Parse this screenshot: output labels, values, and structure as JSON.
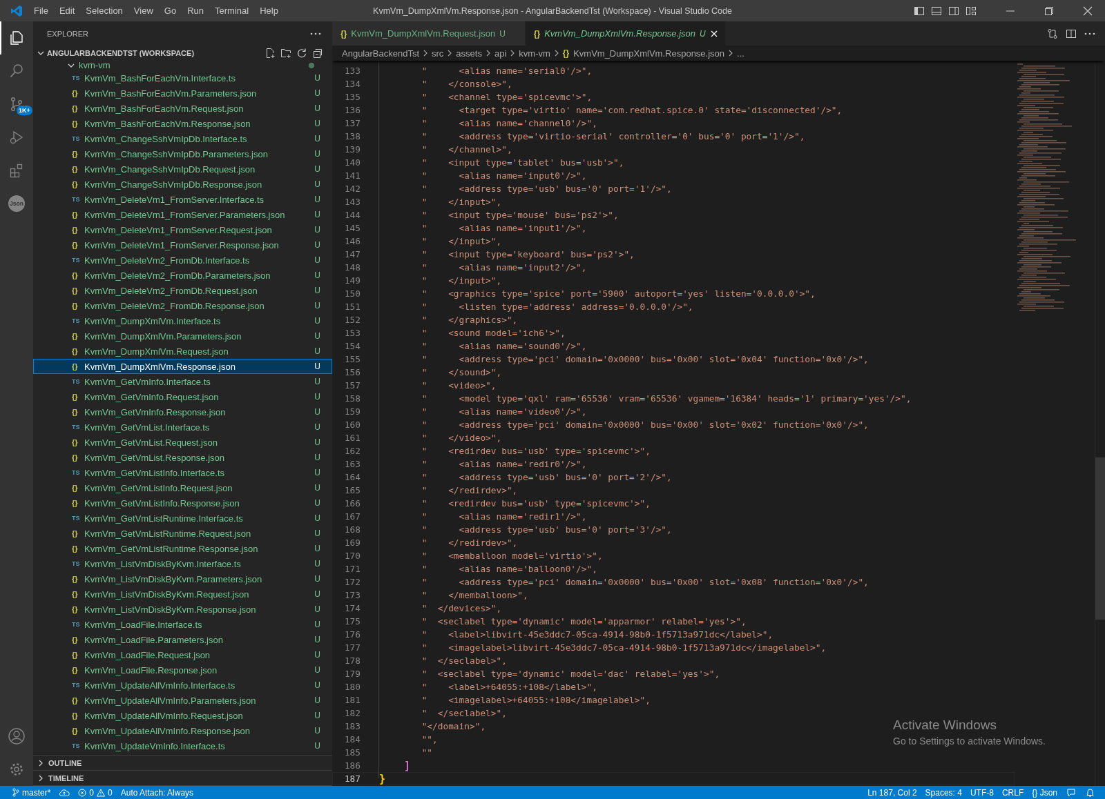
{
  "title_bar": {
    "menus": [
      "File",
      "Edit",
      "Selection",
      "View",
      "Go",
      "Run",
      "Terminal",
      "Help"
    ],
    "title": "KvmVm_DumpXmlVm.Response.json - AngularBackendTst (Workspace) - Visual Studio Code"
  },
  "activity_bar": {
    "source_control_badge": "1K+",
    "json_label": "Json"
  },
  "sidebar": {
    "title": "EXPLORER",
    "workspace": "ANGULARBACKENDTST (WORKSPACE)",
    "folder": {
      "name": "kvm-vm",
      "expanded": true,
      "modified": true
    },
    "files": [
      {
        "kind": "ts",
        "icon": "TS",
        "name": "KvmVm_BashForEachVm.Interface.ts",
        "badge": "U",
        "selected": false
      },
      {
        "kind": "json",
        "icon": "{}",
        "name": "KvmVm_BashForEachVm.Parameters.json",
        "badge": "U",
        "selected": false
      },
      {
        "kind": "json",
        "icon": "{}",
        "name": "KvmVm_BashForEachVm.Request.json",
        "badge": "U",
        "selected": false
      },
      {
        "kind": "json",
        "icon": "{}",
        "name": "KvmVm_BashForEachVm.Response.json",
        "badge": "U",
        "selected": false
      },
      {
        "kind": "ts",
        "icon": "TS",
        "name": "KvmVm_ChangeSshVmIpDb.Interface.ts",
        "badge": "U",
        "selected": false
      },
      {
        "kind": "json",
        "icon": "{}",
        "name": "KvmVm_ChangeSshVmIpDb.Parameters.json",
        "badge": "U",
        "selected": false
      },
      {
        "kind": "json",
        "icon": "{}",
        "name": "KvmVm_ChangeSshVmIpDb.Request.json",
        "badge": "U",
        "selected": false
      },
      {
        "kind": "json",
        "icon": "{}",
        "name": "KvmVm_ChangeSshVmIpDb.Response.json",
        "badge": "U",
        "selected": false
      },
      {
        "kind": "ts",
        "icon": "TS",
        "name": "KvmVm_DeleteVm1_FromServer.Interface.ts",
        "badge": "U",
        "selected": false
      },
      {
        "kind": "json",
        "icon": "{}",
        "name": "KvmVm_DeleteVm1_FromServer.Parameters.json",
        "badge": "U",
        "selected": false
      },
      {
        "kind": "json",
        "icon": "{}",
        "name": "KvmVm_DeleteVm1_FromServer.Request.json",
        "badge": "U",
        "selected": false
      },
      {
        "kind": "json",
        "icon": "{}",
        "name": "KvmVm_DeleteVm1_FromServer.Response.json",
        "badge": "U",
        "selected": false
      },
      {
        "kind": "ts",
        "icon": "TS",
        "name": "KvmVm_DeleteVm2_FromDb.Interface.ts",
        "badge": "U",
        "selected": false
      },
      {
        "kind": "json",
        "icon": "{}",
        "name": "KvmVm_DeleteVm2_FromDb.Parameters.json",
        "badge": "U",
        "selected": false
      },
      {
        "kind": "json",
        "icon": "{}",
        "name": "KvmVm_DeleteVm2_FromDb.Request.json",
        "badge": "U",
        "selected": false
      },
      {
        "kind": "json",
        "icon": "{}",
        "name": "KvmVm_DeleteVm2_FromDb.Response.json",
        "badge": "U",
        "selected": false
      },
      {
        "kind": "ts",
        "icon": "TS",
        "name": "KvmVm_DumpXmlVm.Interface.ts",
        "badge": "U",
        "selected": false
      },
      {
        "kind": "json",
        "icon": "{}",
        "name": "KvmVm_DumpXmlVm.Parameters.json",
        "badge": "U",
        "selected": false
      },
      {
        "kind": "json",
        "icon": "{}",
        "name": "KvmVm_DumpXmlVm.Request.json",
        "badge": "U",
        "selected": false
      },
      {
        "kind": "json",
        "icon": "{}",
        "name": "KvmVm_DumpXmlVm.Response.json",
        "badge": "U",
        "selected": true
      },
      {
        "kind": "ts",
        "icon": "TS",
        "name": "KvmVm_GetVmInfo.Interface.ts",
        "badge": "U",
        "selected": false
      },
      {
        "kind": "json",
        "icon": "{}",
        "name": "KvmVm_GetVmInfo.Request.json",
        "badge": "U",
        "selected": false
      },
      {
        "kind": "json",
        "icon": "{}",
        "name": "KvmVm_GetVmInfo.Response.json",
        "badge": "U",
        "selected": false
      },
      {
        "kind": "ts",
        "icon": "TS",
        "name": "KvmVm_GetVmList.Interface.ts",
        "badge": "U",
        "selected": false
      },
      {
        "kind": "json",
        "icon": "{}",
        "name": "KvmVm_GetVmList.Request.json",
        "badge": "U",
        "selected": false
      },
      {
        "kind": "json",
        "icon": "{}",
        "name": "KvmVm_GetVmList.Response.json",
        "badge": "U",
        "selected": false
      },
      {
        "kind": "ts",
        "icon": "TS",
        "name": "KvmVm_GetVmListInfo.Interface.ts",
        "badge": "U",
        "selected": false
      },
      {
        "kind": "json",
        "icon": "{}",
        "name": "KvmVm_GetVmListInfo.Request.json",
        "badge": "U",
        "selected": false
      },
      {
        "kind": "json",
        "icon": "{}",
        "name": "KvmVm_GetVmListInfo.Response.json",
        "badge": "U",
        "selected": false
      },
      {
        "kind": "ts",
        "icon": "TS",
        "name": "KvmVm_GetVmListRuntime.Interface.ts",
        "badge": "U",
        "selected": false
      },
      {
        "kind": "json",
        "icon": "{}",
        "name": "KvmVm_GetVmListRuntime.Request.json",
        "badge": "U",
        "selected": false
      },
      {
        "kind": "json",
        "icon": "{}",
        "name": "KvmVm_GetVmListRuntime.Response.json",
        "badge": "U",
        "selected": false
      },
      {
        "kind": "ts",
        "icon": "TS",
        "name": "KvmVm_ListVmDiskByKvm.Interface.ts",
        "badge": "U",
        "selected": false
      },
      {
        "kind": "json",
        "icon": "{}",
        "name": "KvmVm_ListVmDiskByKvm.Parameters.json",
        "badge": "U",
        "selected": false
      },
      {
        "kind": "json",
        "icon": "{}",
        "name": "KvmVm_ListVmDiskByKvm.Request.json",
        "badge": "U",
        "selected": false
      },
      {
        "kind": "json",
        "icon": "{}",
        "name": "KvmVm_ListVmDiskByKvm.Response.json",
        "badge": "U",
        "selected": false
      },
      {
        "kind": "ts",
        "icon": "TS",
        "name": "KvmVm_LoadFile.Interface.ts",
        "badge": "U",
        "selected": false
      },
      {
        "kind": "json",
        "icon": "{}",
        "name": "KvmVm_LoadFile.Parameters.json",
        "badge": "U",
        "selected": false
      },
      {
        "kind": "json",
        "icon": "{}",
        "name": "KvmVm_LoadFile.Request.json",
        "badge": "U",
        "selected": false
      },
      {
        "kind": "json",
        "icon": "{}",
        "name": "KvmVm_LoadFile.Response.json",
        "badge": "U",
        "selected": false
      },
      {
        "kind": "ts",
        "icon": "TS",
        "name": "KvmVm_UpdateAllVmInfo.Interface.ts",
        "badge": "U",
        "selected": false
      },
      {
        "kind": "json",
        "icon": "{}",
        "name": "KvmVm_UpdateAllVmInfo.Parameters.json",
        "badge": "U",
        "selected": false
      },
      {
        "kind": "json",
        "icon": "{}",
        "name": "KvmVm_UpdateAllVmInfo.Request.json",
        "badge": "U",
        "selected": false
      },
      {
        "kind": "json",
        "icon": "{}",
        "name": "KvmVm_UpdateAllVmInfo.Response.json",
        "badge": "U",
        "selected": false
      },
      {
        "kind": "ts",
        "icon": "TS",
        "name": "KvmVm_UpdateVmInfo.Interface.ts",
        "badge": "U",
        "selected": false
      }
    ],
    "sections": [
      {
        "label": "OUTLINE",
        "expanded": false
      },
      {
        "label": "TIMELINE",
        "expanded": false
      }
    ]
  },
  "tabs": [
    {
      "icon": "{}",
      "label": "KvmVm_DumpXmlVm.Request.json",
      "badge": "U",
      "selected": false,
      "preview": false
    },
    {
      "icon": "{}",
      "label": "KvmVm_DumpXmlVm.Response.json",
      "badge": "U",
      "selected": true,
      "preview": true
    }
  ],
  "breadcrumbs": [
    {
      "label": "AngularBackendTst"
    },
    {
      "label": "src"
    },
    {
      "label": "assets"
    },
    {
      "label": "api"
    },
    {
      "label": "kvm-vm"
    },
    {
      "label": "KvmVm_DumpXmlVm.Response.json",
      "icon": "{}"
    },
    {
      "label": "..."
    }
  ],
  "editor": {
    "lines": [
      {
        "number": "133",
        "kind": "string",
        "current": false,
        "text": "        \"      <alias name='serial0'/>\","
      },
      {
        "number": "134",
        "kind": "string",
        "current": false,
        "text": "        \"    </console>\","
      },
      {
        "number": "135",
        "kind": "string",
        "current": false,
        "text": "        \"    <channel type='spicevmc'>\","
      },
      {
        "number": "136",
        "kind": "string",
        "current": false,
        "text": "        \"      <target type='virtio' name='com.redhat.spice.0' state='disconnected'/>\","
      },
      {
        "number": "137",
        "kind": "string",
        "current": false,
        "text": "        \"      <alias name='channel0'/>\","
      },
      {
        "number": "138",
        "kind": "string",
        "current": false,
        "text": "        \"      <address type='virtio-serial' controller='0' bus='0' port='1'/>\","
      },
      {
        "number": "139",
        "kind": "string",
        "current": false,
        "text": "        \"    </channel>\","
      },
      {
        "number": "140",
        "kind": "string",
        "current": false,
        "text": "        \"    <input type='tablet' bus='usb'>\","
      },
      {
        "number": "141",
        "kind": "string",
        "current": false,
        "text": "        \"      <alias name='input0'/>\","
      },
      {
        "number": "142",
        "kind": "string",
        "current": false,
        "text": "        \"      <address type='usb' bus='0' port='1'/>\","
      },
      {
        "number": "143",
        "kind": "string",
        "current": false,
        "text": "        \"    </input>\","
      },
      {
        "number": "144",
        "kind": "string",
        "current": false,
        "text": "        \"    <input type='mouse' bus='ps2'>\","
      },
      {
        "number": "145",
        "kind": "string",
        "current": false,
        "text": "        \"      <alias name='input1'/>\","
      },
      {
        "number": "146",
        "kind": "string",
        "current": false,
        "text": "        \"    </input>\","
      },
      {
        "number": "147",
        "kind": "string",
        "current": false,
        "text": "        \"    <input type='keyboard' bus='ps2'>\","
      },
      {
        "number": "148",
        "kind": "string",
        "current": false,
        "text": "        \"      <alias name='input2'/>\","
      },
      {
        "number": "149",
        "kind": "string",
        "current": false,
        "text": "        \"    </input>\","
      },
      {
        "number": "150",
        "kind": "string",
        "current": false,
        "text": "        \"    <graphics type='spice' port='5900' autoport='yes' listen='0.0.0.0'>\","
      },
      {
        "number": "151",
        "kind": "string",
        "current": false,
        "text": "        \"      <listen type='address' address='0.0.0.0'/>\","
      },
      {
        "number": "152",
        "kind": "string",
        "current": false,
        "text": "        \"    </graphics>\","
      },
      {
        "number": "153",
        "kind": "string",
        "current": false,
        "text": "        \"    <sound model='ich6'>\","
      },
      {
        "number": "154",
        "kind": "string",
        "current": false,
        "text": "        \"      <alias name='sound0'/>\","
      },
      {
        "number": "155",
        "kind": "string",
        "current": false,
        "text": "        \"      <address type='pci' domain='0x0000' bus='0x00' slot='0x04' function='0x0'/>\","
      },
      {
        "number": "156",
        "kind": "string",
        "current": false,
        "text": "        \"    </sound>\","
      },
      {
        "number": "157",
        "kind": "string",
        "current": false,
        "text": "        \"    <video>\","
      },
      {
        "number": "158",
        "kind": "string",
        "current": false,
        "text": "        \"      <model type='qxl' ram='65536' vram='65536' vgamem='16384' heads='1' primary='yes'/>\","
      },
      {
        "number": "159",
        "kind": "string",
        "current": false,
        "text": "        \"      <alias name='video0'/>\","
      },
      {
        "number": "160",
        "kind": "string",
        "current": false,
        "text": "        \"      <address type='pci' domain='0x0000' bus='0x00' slot='0x02' function='0x0'/>\","
      },
      {
        "number": "161",
        "kind": "string",
        "current": false,
        "text": "        \"    </video>\","
      },
      {
        "number": "162",
        "kind": "string",
        "current": false,
        "text": "        \"    <redirdev bus='usb' type='spicevmc'>\","
      },
      {
        "number": "163",
        "kind": "string",
        "current": false,
        "text": "        \"      <alias name='redir0'/>\","
      },
      {
        "number": "164",
        "kind": "string",
        "current": false,
        "text": "        \"      <address type='usb' bus='0' port='2'/>\","
      },
      {
        "number": "165",
        "kind": "string",
        "current": false,
        "text": "        \"    </redirdev>\","
      },
      {
        "number": "166",
        "kind": "string",
        "current": false,
        "text": "        \"    <redirdev bus='usb' type='spicevmc'>\","
      },
      {
        "number": "167",
        "kind": "string",
        "current": false,
        "text": "        \"      <alias name='redir1'/>\","
      },
      {
        "number": "168",
        "kind": "string",
        "current": false,
        "text": "        \"      <address type='usb' bus='0' port='3'/>\","
      },
      {
        "number": "169",
        "kind": "string",
        "current": false,
        "text": "        \"    </redirdev>\","
      },
      {
        "number": "170",
        "kind": "string",
        "current": false,
        "text": "        \"    <memballoon model='virtio'>\","
      },
      {
        "number": "171",
        "kind": "string",
        "current": false,
        "text": "        \"      <alias name='balloon0'/>\","
      },
      {
        "number": "172",
        "kind": "string",
        "current": false,
        "text": "        \"      <address type='pci' domain='0x0000' bus='0x00' slot='0x08' function='0x0'/>\","
      },
      {
        "number": "173",
        "kind": "string",
        "current": false,
        "text": "        \"    </memballoon>\","
      },
      {
        "number": "174",
        "kind": "string",
        "current": false,
        "text": "        \"  </devices>\","
      },
      {
        "number": "175",
        "kind": "string",
        "current": false,
        "text": "        \"  <seclabel type='dynamic' model='apparmor' relabel='yes'>\","
      },
      {
        "number": "176",
        "kind": "string",
        "current": false,
        "text": "        \"    <label>libvirt-45e3ddc7-05ca-4914-98b0-1f5713a971dc</label>\","
      },
      {
        "number": "177",
        "kind": "string",
        "current": false,
        "text": "        \"    <imagelabel>libvirt-45e3ddc7-05ca-4914-98b0-1f5713a971dc</imagelabel>\","
      },
      {
        "number": "178",
        "kind": "string",
        "current": false,
        "text": "        \"  </seclabel>\","
      },
      {
        "number": "179",
        "kind": "string",
        "current": false,
        "text": "        \"  <seclabel type='dynamic' model='dac' relabel='yes'>\","
      },
      {
        "number": "180",
        "kind": "string",
        "current": false,
        "text": "        \"    <label>+64055:+108</label>\","
      },
      {
        "number": "181",
        "kind": "string",
        "current": false,
        "text": "        \"    <imagelabel>+64055:+108</imagelabel>\","
      },
      {
        "number": "182",
        "kind": "string",
        "current": false,
        "text": "        \"  </seclabel>\","
      },
      {
        "number": "183",
        "kind": "string",
        "current": false,
        "text": "        \"</domain>\","
      },
      {
        "number": "184",
        "kind": "string",
        "current": false,
        "text": "        \"\","
      },
      {
        "number": "185",
        "kind": "string",
        "current": false,
        "text": "        \"\""
      },
      {
        "number": "186",
        "kind": "bracket",
        "color": "#da70d6",
        "current": false,
        "text": "    ]"
      },
      {
        "number": "187",
        "kind": "bracket",
        "color": "#ffd700",
        "current": true,
        "text": "}"
      }
    ]
  },
  "status_bar": {
    "branch": "master*",
    "errors": "0",
    "warnings": "0",
    "auto_attach": "Auto Attach: Always",
    "position": "Ln 187, Col 2",
    "spaces": "Spaces: 4",
    "encoding": "UTF-8",
    "eol": "CRLF",
    "language_icon": "{}",
    "language": "Json"
  },
  "os_notice": {
    "title": "Activate Windows",
    "text": "Go to Settings to activate Windows."
  }
}
